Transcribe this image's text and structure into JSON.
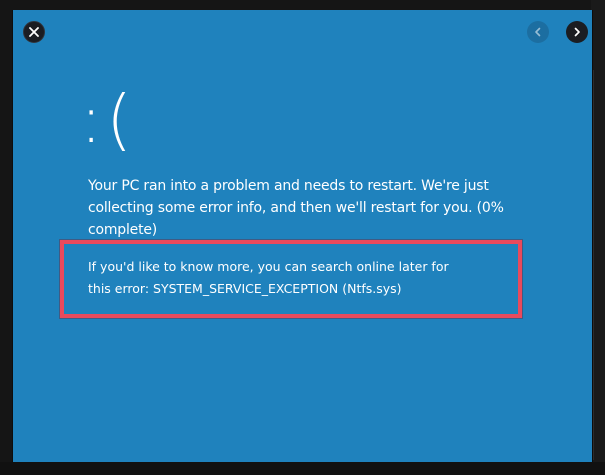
{
  "controls": {
    "close_icon": "close-icon",
    "prev_icon": "chevron-left-icon",
    "next_icon": "chevron-right-icon"
  },
  "screen": {
    "background_color": "#1f82bd",
    "highlight_color": "#e94a5d",
    "emoticon": ":(",
    "message": "Your PC ran into a problem and needs to restart. We're just collecting some error info, and then we'll restart for you. (0% complete)",
    "more_info": "If you'd like to know more, you can search online later for this error: SYSTEM_SERVICE_EXCEPTION (Ntfs.sys)"
  }
}
